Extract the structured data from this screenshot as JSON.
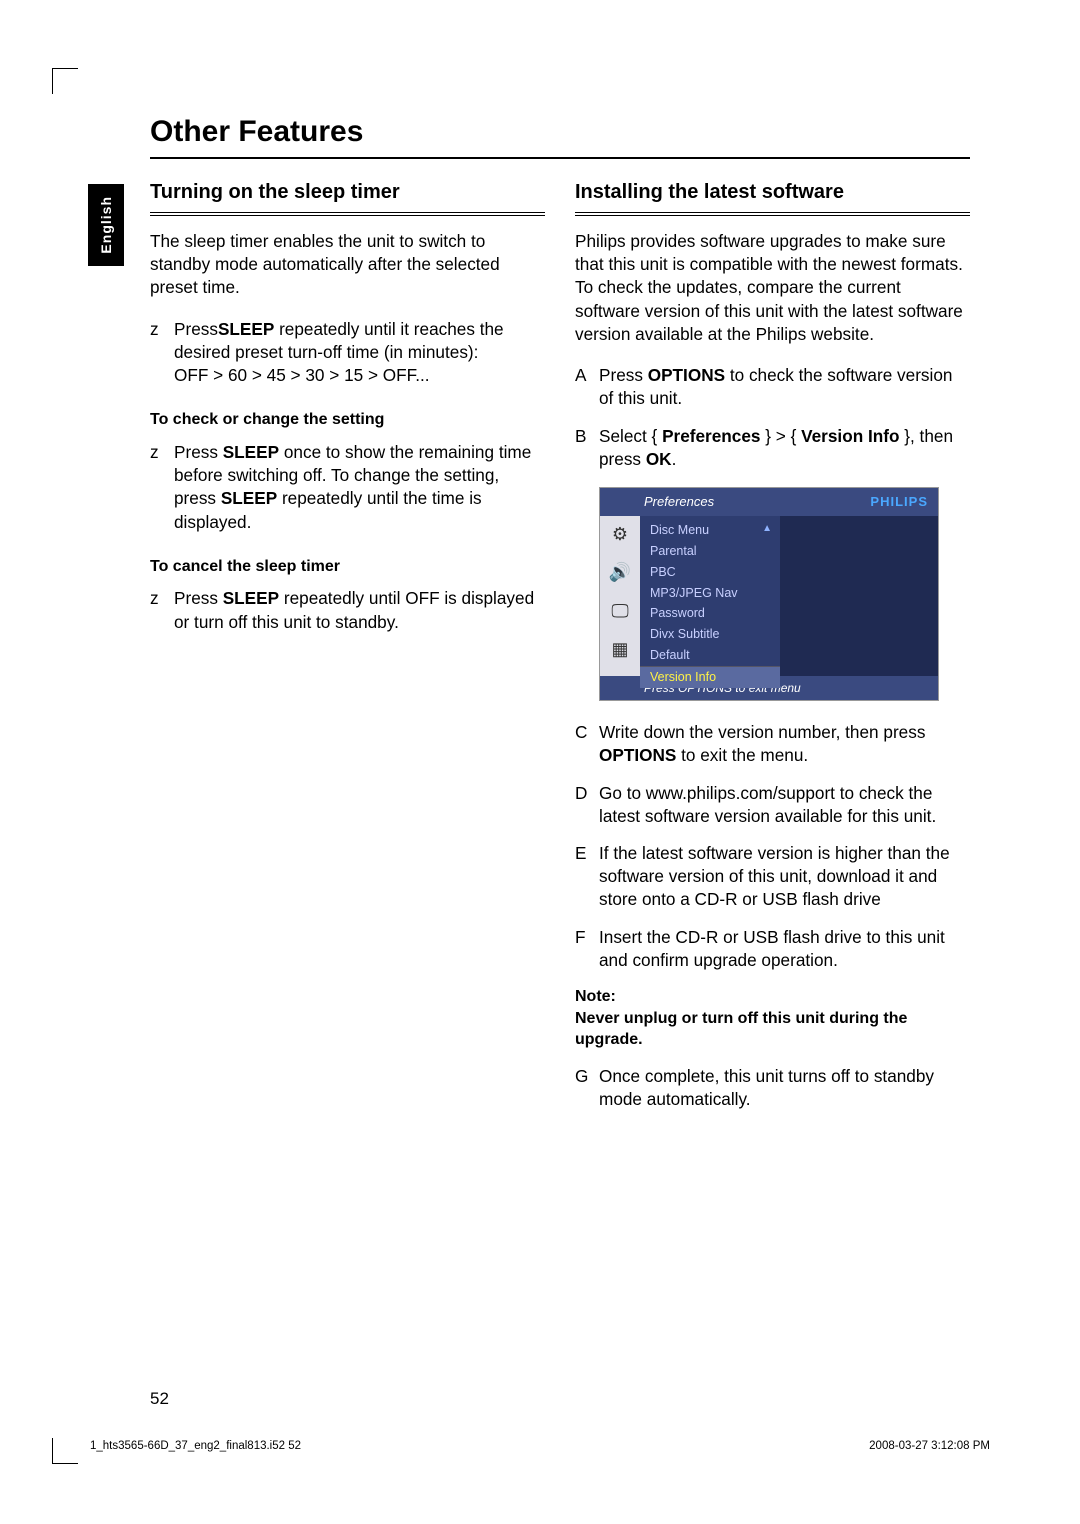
{
  "lang_tab": "English",
  "title": "Other Features",
  "left": {
    "heading": "Turning on the sleep timer",
    "intro": "The sleep timer enables the unit to switch to standby mode automatically after the selected preset time.",
    "step1_mk": "z",
    "step1_a": "Press",
    "step1_b": "SLEEP",
    "step1_c": " repeatedly until it reaches the desired preset turn-off time (in minutes):",
    "step1_d": "OFF > 60 > 45 > 30 > 15 > OFF...",
    "sub1": "To check or change the setting",
    "step2_mk": "z",
    "step2_a": "Press ",
    "step2_b": "SLEEP",
    "step2_c": " once to show the remaining time before switching off. To change the setting, press ",
    "step2_d": "SLEEP",
    "step2_e": " repeatedly until the time is displayed.",
    "sub2": "To cancel the sleep timer",
    "step3_mk": "z",
    "step3_a": "Press ",
    "step3_b": "SLEEP",
    "step3_c": " repeatedly until  OFF  is displayed or turn off this unit to standby."
  },
  "right": {
    "heading": "Installing the latest software",
    "intro": "Philips provides software upgrades to make sure that this unit is compatible with the newest formats. To check the updates, compare the current software version of this unit with the latest software version available at the Philips website.",
    "sA_mk": "A",
    "sA_a": "Press ",
    "sA_b": "OPTIONS",
    "sA_c": " to check the software version of this unit.",
    "sB_mk": "B",
    "sB_a": "Select { ",
    "sB_b": "Preferences",
    "sB_c": " } > { ",
    "sB_d": "Version Info",
    "sB_e": " }, then press ",
    "sB_f": "OK",
    "sB_g": ".",
    "menu": {
      "title": "Preferences",
      "brand": "PHILIPS",
      "items": [
        "Disc Menu",
        "Parental",
        "PBC",
        "MP3/JPEG Nav",
        "Password",
        "Divx Subtitle",
        "Default",
        "Version Info"
      ],
      "selected_index": 7,
      "arrow_index": 0,
      "footer": "Press OPTIONS to exit menu"
    },
    "sC_mk": "C",
    "sC_a": "Write down the version number, then press ",
    "sC_b": "OPTIONS",
    "sC_c": " to exit the menu.",
    "sD_mk": "D",
    "sD": "Go to www.philips.com/support to check the latest software version available for this unit.",
    "sE_mk": "E",
    "sE": "If the latest software version is higher than the software version of this unit, download it and store onto a CD-R or USB ﬂash drive",
    "sF_mk": "F",
    "sF": "Insert the CD-R or USB ﬂash drive to this unit and conﬁrm upgrade operation.",
    "note_label": "Note:",
    "note_text": "Never unplug or turn off this unit during the upgrade.",
    "sG_mk": "G",
    "sG": "Once complete, this unit turns off to standby mode automatically."
  },
  "page_number": "52",
  "footer_left": "1_hts3565-66D_37_eng2_final813.i52   52",
  "footer_right": "2008-03-27   3:12:08 PM"
}
